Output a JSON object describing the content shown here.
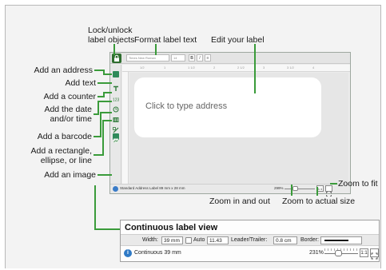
{
  "annotations": {
    "lock_unlock_line1": "Lock/unlock",
    "lock_unlock_line2": "label objects",
    "format_text": "Format label text",
    "edit_label": "Edit your label",
    "add_address": "Add an address",
    "add_text": "Add text",
    "add_counter": "Add a counter",
    "add_date_line1": "Add the date",
    "add_date_line2": "and/or time",
    "add_barcode": "Add a barcode",
    "add_shape_line1": "Add a rectangle,",
    "add_shape_line2": "ellipse, or line",
    "add_image": "Add  an image",
    "zoom_to_fit": "Zoom to fit",
    "zoom_in_out": "Zoom in and out",
    "zoom_actual": "Zoom to actual size"
  },
  "editor": {
    "font_name": "Times New Roman",
    "font_size": "14",
    "bold": "B",
    "italic": "I",
    "align": "≡",
    "ruler_ticks": [
      "1/2",
      "1",
      "1 1/2",
      "2",
      "2 1/2",
      "3",
      "3 1/2",
      "4"
    ],
    "placeholder": "Click to type address",
    "status": "Standard Address Label 89 mm x 28 mm",
    "zoom": "299%",
    "actual_size": "1:1"
  },
  "sidebar_icons": [
    "address-icon",
    "text-icon",
    "counter-icon",
    "date-time-icon",
    "barcode-icon",
    "shape-icon",
    "image-icon"
  ],
  "continuous": {
    "title": "Continuous label view",
    "width_label": "Width:",
    "width_value": "39 mm",
    "auto_label": "Auto",
    "auto_value": "11.43",
    "leader_label": "Leader/Trailer:",
    "leader_value": "0.8 cm",
    "border_label": "Border:",
    "status": "Continuous 39 mm",
    "zoom": "231%",
    "actual_size": "1:1"
  },
  "colors": {
    "guide": "#3a9b3a",
    "info": "#2f7ac6",
    "lock_button": "#2f6e2f"
  }
}
